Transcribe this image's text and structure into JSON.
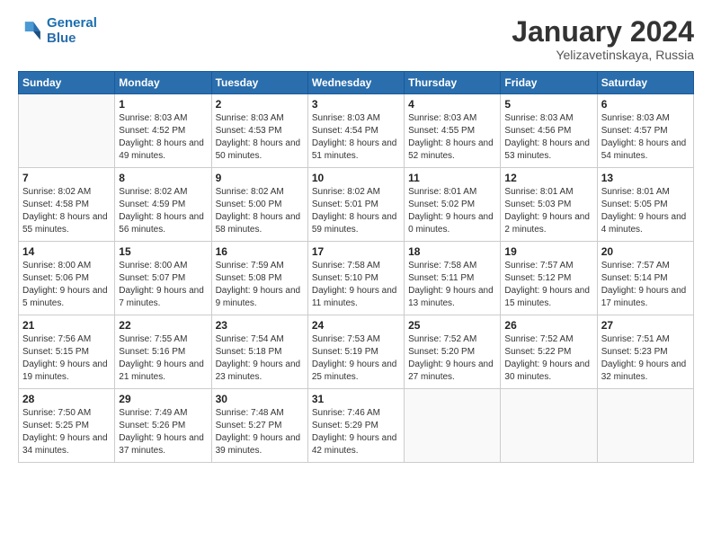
{
  "logo": {
    "line1": "General",
    "line2": "Blue"
  },
  "title": "January 2024",
  "subtitle": "Yelizavetinskaya, Russia",
  "header": {
    "days": [
      "Sunday",
      "Monday",
      "Tuesday",
      "Wednesday",
      "Thursday",
      "Friday",
      "Saturday"
    ]
  },
  "weeks": [
    [
      {
        "day": "",
        "sunrise": "",
        "sunset": "",
        "daylight": ""
      },
      {
        "day": "1",
        "sunrise": "Sunrise: 8:03 AM",
        "sunset": "Sunset: 4:52 PM",
        "daylight": "Daylight: 8 hours and 49 minutes."
      },
      {
        "day": "2",
        "sunrise": "Sunrise: 8:03 AM",
        "sunset": "Sunset: 4:53 PM",
        "daylight": "Daylight: 8 hours and 50 minutes."
      },
      {
        "day": "3",
        "sunrise": "Sunrise: 8:03 AM",
        "sunset": "Sunset: 4:54 PM",
        "daylight": "Daylight: 8 hours and 51 minutes."
      },
      {
        "day": "4",
        "sunrise": "Sunrise: 8:03 AM",
        "sunset": "Sunset: 4:55 PM",
        "daylight": "Daylight: 8 hours and 52 minutes."
      },
      {
        "day": "5",
        "sunrise": "Sunrise: 8:03 AM",
        "sunset": "Sunset: 4:56 PM",
        "daylight": "Daylight: 8 hours and 53 minutes."
      },
      {
        "day": "6",
        "sunrise": "Sunrise: 8:03 AM",
        "sunset": "Sunset: 4:57 PM",
        "daylight": "Daylight: 8 hours and 54 minutes."
      }
    ],
    [
      {
        "day": "7",
        "sunrise": "Sunrise: 8:02 AM",
        "sunset": "Sunset: 4:58 PM",
        "daylight": "Daylight: 8 hours and 55 minutes."
      },
      {
        "day": "8",
        "sunrise": "Sunrise: 8:02 AM",
        "sunset": "Sunset: 4:59 PM",
        "daylight": "Daylight: 8 hours and 56 minutes."
      },
      {
        "day": "9",
        "sunrise": "Sunrise: 8:02 AM",
        "sunset": "Sunset: 5:00 PM",
        "daylight": "Daylight: 8 hours and 58 minutes."
      },
      {
        "day": "10",
        "sunrise": "Sunrise: 8:02 AM",
        "sunset": "Sunset: 5:01 PM",
        "daylight": "Daylight: 8 hours and 59 minutes."
      },
      {
        "day": "11",
        "sunrise": "Sunrise: 8:01 AM",
        "sunset": "Sunset: 5:02 PM",
        "daylight": "Daylight: 9 hours and 0 minutes."
      },
      {
        "day": "12",
        "sunrise": "Sunrise: 8:01 AM",
        "sunset": "Sunset: 5:03 PM",
        "daylight": "Daylight: 9 hours and 2 minutes."
      },
      {
        "day": "13",
        "sunrise": "Sunrise: 8:01 AM",
        "sunset": "Sunset: 5:05 PM",
        "daylight": "Daylight: 9 hours and 4 minutes."
      }
    ],
    [
      {
        "day": "14",
        "sunrise": "Sunrise: 8:00 AM",
        "sunset": "Sunset: 5:06 PM",
        "daylight": "Daylight: 9 hours and 5 minutes."
      },
      {
        "day": "15",
        "sunrise": "Sunrise: 8:00 AM",
        "sunset": "Sunset: 5:07 PM",
        "daylight": "Daylight: 9 hours and 7 minutes."
      },
      {
        "day": "16",
        "sunrise": "Sunrise: 7:59 AM",
        "sunset": "Sunset: 5:08 PM",
        "daylight": "Daylight: 9 hours and 9 minutes."
      },
      {
        "day": "17",
        "sunrise": "Sunrise: 7:58 AM",
        "sunset": "Sunset: 5:10 PM",
        "daylight": "Daylight: 9 hours and 11 minutes."
      },
      {
        "day": "18",
        "sunrise": "Sunrise: 7:58 AM",
        "sunset": "Sunset: 5:11 PM",
        "daylight": "Daylight: 9 hours and 13 minutes."
      },
      {
        "day": "19",
        "sunrise": "Sunrise: 7:57 AM",
        "sunset": "Sunset: 5:12 PM",
        "daylight": "Daylight: 9 hours and 15 minutes."
      },
      {
        "day": "20",
        "sunrise": "Sunrise: 7:57 AM",
        "sunset": "Sunset: 5:14 PM",
        "daylight": "Daylight: 9 hours and 17 minutes."
      }
    ],
    [
      {
        "day": "21",
        "sunrise": "Sunrise: 7:56 AM",
        "sunset": "Sunset: 5:15 PM",
        "daylight": "Daylight: 9 hours and 19 minutes."
      },
      {
        "day": "22",
        "sunrise": "Sunrise: 7:55 AM",
        "sunset": "Sunset: 5:16 PM",
        "daylight": "Daylight: 9 hours and 21 minutes."
      },
      {
        "day": "23",
        "sunrise": "Sunrise: 7:54 AM",
        "sunset": "Sunset: 5:18 PM",
        "daylight": "Daylight: 9 hours and 23 minutes."
      },
      {
        "day": "24",
        "sunrise": "Sunrise: 7:53 AM",
        "sunset": "Sunset: 5:19 PM",
        "daylight": "Daylight: 9 hours and 25 minutes."
      },
      {
        "day": "25",
        "sunrise": "Sunrise: 7:52 AM",
        "sunset": "Sunset: 5:20 PM",
        "daylight": "Daylight: 9 hours and 27 minutes."
      },
      {
        "day": "26",
        "sunrise": "Sunrise: 7:52 AM",
        "sunset": "Sunset: 5:22 PM",
        "daylight": "Daylight: 9 hours and 30 minutes."
      },
      {
        "day": "27",
        "sunrise": "Sunrise: 7:51 AM",
        "sunset": "Sunset: 5:23 PM",
        "daylight": "Daylight: 9 hours and 32 minutes."
      }
    ],
    [
      {
        "day": "28",
        "sunrise": "Sunrise: 7:50 AM",
        "sunset": "Sunset: 5:25 PM",
        "daylight": "Daylight: 9 hours and 34 minutes."
      },
      {
        "day": "29",
        "sunrise": "Sunrise: 7:49 AM",
        "sunset": "Sunset: 5:26 PM",
        "daylight": "Daylight: 9 hours and 37 minutes."
      },
      {
        "day": "30",
        "sunrise": "Sunrise: 7:48 AM",
        "sunset": "Sunset: 5:27 PM",
        "daylight": "Daylight: 9 hours and 39 minutes."
      },
      {
        "day": "31",
        "sunrise": "Sunrise: 7:46 AM",
        "sunset": "Sunset: 5:29 PM",
        "daylight": "Daylight: 9 hours and 42 minutes."
      },
      {
        "day": "",
        "sunrise": "",
        "sunset": "",
        "daylight": ""
      },
      {
        "day": "",
        "sunrise": "",
        "sunset": "",
        "daylight": ""
      },
      {
        "day": "",
        "sunrise": "",
        "sunset": "",
        "daylight": ""
      }
    ]
  ]
}
